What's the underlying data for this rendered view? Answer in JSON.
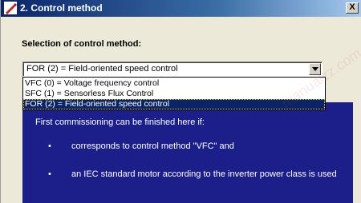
{
  "window": {
    "title": "2. Control method",
    "close_label": "X"
  },
  "form": {
    "section_label": "Selection of control method:"
  },
  "combo": {
    "value": "FOR (2) = Field-oriented speed control",
    "options": [
      "VFC (0) = Voltage frequency control",
      "SFC (1) = Sensorless Flux Control",
      "FOR (2) = Field-oriented speed control"
    ]
  },
  "info": {
    "intro": "First commissioning can be finished here if:",
    "bullet_char": "•",
    "bullets": [
      "corresponds to control method \"VFC\" and",
      "an IEC standard motor according to the inverter power class is used"
    ]
  },
  "watermark": {
    "text": "manualzz.com / manualsbox.pl"
  },
  "colors": {
    "titlebar": "#0a246a",
    "panel": "#1c1f8a",
    "selection": "#0a246a"
  }
}
